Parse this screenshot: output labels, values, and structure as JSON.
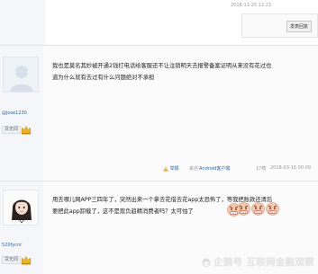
{
  "top": {
    "timestamp": "2018-11-25 12:23",
    "reply_label": "发表回复"
  },
  "post1": {
    "username": "@jose1230",
    "level": "贷无闻",
    "content_line1": "我也是莫名其妙被开通2钱打电话给客服还不让注销明天去报警备案证明从来没有花过也",
    "content_line2": "道为什么就有去过有什么问题绝对不承担",
    "report_label": "举报",
    "source_prefix": "来自",
    "source_name": "Android客户端",
    "floor": "17楼",
    "timestamp": "2018-03-16 00:09"
  },
  "post2": {
    "username": "520fycnr",
    "level": "贷无闻",
    "content_line1": "用去哪儿网APP三四年了，突然出来一个拿去花借去花app太恐怖了，等我把账款还清后",
    "content_line2": "要把此app卸载了，这不是欺负趋精消费者吗？太可怕了"
  },
  "watermark": {
    "text": "企鹅号 互联网金融观察"
  },
  "colors": {
    "link": "#2d64b3",
    "muted": "#999999",
    "sidebar_bg": "#f4f6f9",
    "emoji_red": "#e8483b"
  }
}
